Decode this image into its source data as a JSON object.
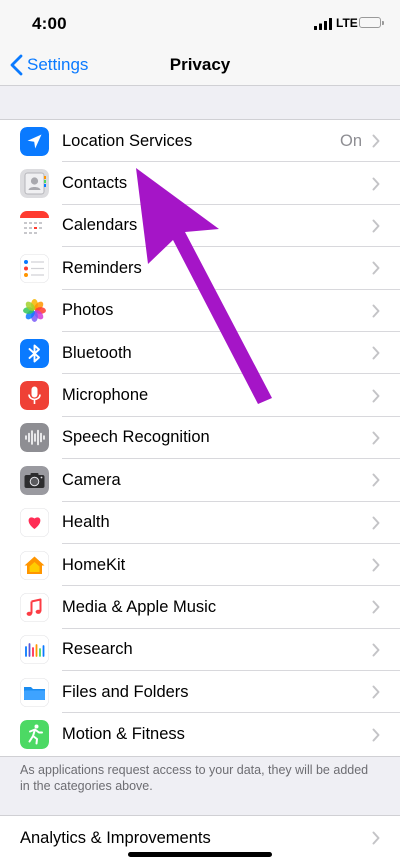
{
  "status_bar": {
    "time": "4:00",
    "network": "LTE",
    "signal_icon": "signal-bars-icon",
    "battery_icon": "battery-icon",
    "battery_color": "#f5c524"
  },
  "nav": {
    "back_label": "Settings",
    "title": "Privacy",
    "accent_color": "#0a7aff"
  },
  "items": [
    {
      "label": "Location Services",
      "detail": "On",
      "icon": "location-arrow-icon",
      "color": "#0a7aff"
    },
    {
      "label": "Contacts",
      "detail": "",
      "icon": "contacts-icon",
      "color": "#c9c9ce"
    },
    {
      "label": "Calendars",
      "detail": "",
      "icon": "calendar-icon",
      "color": "#ff3b30"
    },
    {
      "label": "Reminders",
      "detail": "",
      "icon": "reminders-icon",
      "color": "#ffffff"
    },
    {
      "label": "Photos",
      "detail": "",
      "icon": "photos-icon",
      "color": "#ffffff"
    },
    {
      "label": "Bluetooth",
      "detail": "",
      "icon": "bluetooth-icon",
      "color": "#0a7aff"
    },
    {
      "label": "Microphone",
      "detail": "",
      "icon": "microphone-icon",
      "color": "#ef4136"
    },
    {
      "label": "Speech Recognition",
      "detail": "",
      "icon": "speech-waveform-icon",
      "color": "#8e8e93"
    },
    {
      "label": "Camera",
      "detail": "",
      "icon": "camera-icon",
      "color": "#8e8e93"
    },
    {
      "label": "Health",
      "detail": "",
      "icon": "heart-icon",
      "color": "#ff2d55"
    },
    {
      "label": "HomeKit",
      "detail": "",
      "icon": "home-icon",
      "color": "#ff9500"
    },
    {
      "label": "Media & Apple Music",
      "detail": "",
      "icon": "music-note-icon",
      "color": "#fc3c44"
    },
    {
      "label": "Research",
      "detail": "",
      "icon": "research-icon",
      "color": "#0a7aff"
    },
    {
      "label": "Files and Folders",
      "detail": "",
      "icon": "folder-icon",
      "color": "#1a8cf0"
    },
    {
      "label": "Motion & Fitness",
      "detail": "",
      "icon": "motion-fitness-icon",
      "color": "#4cd964"
    }
  ],
  "footer_note": "As applications request access to your data, they will be added in the categories above.",
  "analytics": {
    "label": "Analytics & Improvements"
  },
  "annotation": {
    "arrow_icon": "annotation-arrow-icon",
    "arrow_color": "#a515c7"
  }
}
